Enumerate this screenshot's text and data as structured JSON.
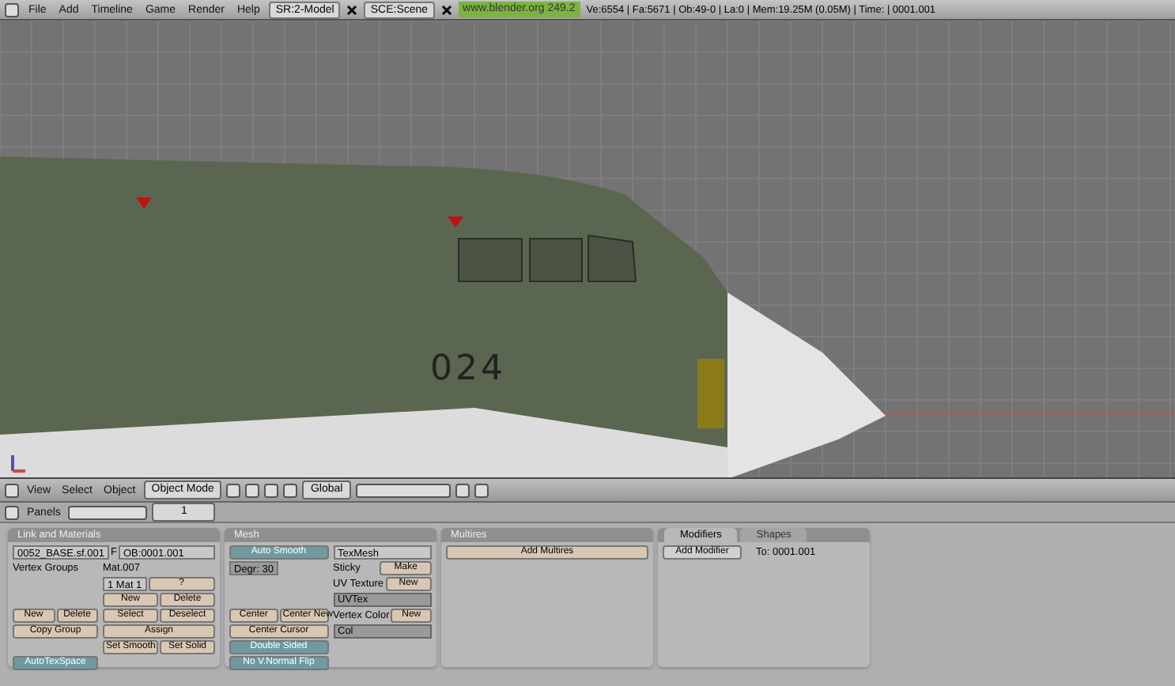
{
  "top_bar": {
    "menus": [
      "File",
      "Add",
      "Timeline",
      "Game",
      "Render",
      "Help"
    ],
    "screen": "SR:2-Model",
    "scene": "SCE:Scene",
    "version": "www.blender.org 249.2",
    "stats": "Ve:6554 | Fa:5671 | Ob:49-0 | La:0  | Mem:19.25M (0.05M)  | Time: | 0001.001"
  },
  "viewport": {
    "marking": "024"
  },
  "view_header": {
    "menus": [
      "View",
      "Select",
      "Object"
    ],
    "mode": "Object Mode",
    "orientation": "Global"
  },
  "buttons_header": {
    "label": "Panels",
    "frame": "1"
  },
  "link_materials": {
    "title": "Link and Materials",
    "mesh_name": "0052_BASE.sf.001",
    "mesh_flag": "F",
    "object_name": "OB:0001.001",
    "vertex_groups_label": "Vertex Groups",
    "material_label": "Mat.007",
    "material_index": "1 Mat 1",
    "help": "?",
    "group_buttons": [
      "New",
      "Delete",
      "Copy Group"
    ],
    "material_buttons": [
      "New",
      "Delete",
      "Select",
      "Deselect",
      "Assign"
    ],
    "autotexspace": {
      "label": "AutoTexSpace",
      "on": true
    },
    "smooth_buttons": [
      "Set Smooth",
      "Set Solid"
    ]
  },
  "mesh": {
    "title": "Mesh",
    "auto_smooth": {
      "label": "Auto Smooth",
      "on": true
    },
    "degr": "Degr: 30",
    "texmesh": "TexMesh",
    "sticky": {
      "label": "Sticky",
      "button": "Make"
    },
    "uv_texture": {
      "label": "UV Texture",
      "button": "New",
      "layer": "UVTex"
    },
    "vertex_color": {
      "label": "Vertex Color",
      "button": "New",
      "layer": "Col"
    },
    "center_buttons": [
      "Center",
      "Center New",
      "Center Cursor"
    ],
    "double_sided": {
      "label": "Double Sided",
      "on": true
    },
    "no_vnormal_flip": {
      "label": "No V.Normal Flip",
      "on": true
    }
  },
  "multires": {
    "title": "Multires",
    "button": "Add Multires"
  },
  "modifiers": {
    "tabs": [
      {
        "label": "Modifiers",
        "selected": true
      },
      {
        "label": "Shapes",
        "selected": false
      }
    ],
    "button": "Add Modifier",
    "target": "To: 0001.001"
  }
}
